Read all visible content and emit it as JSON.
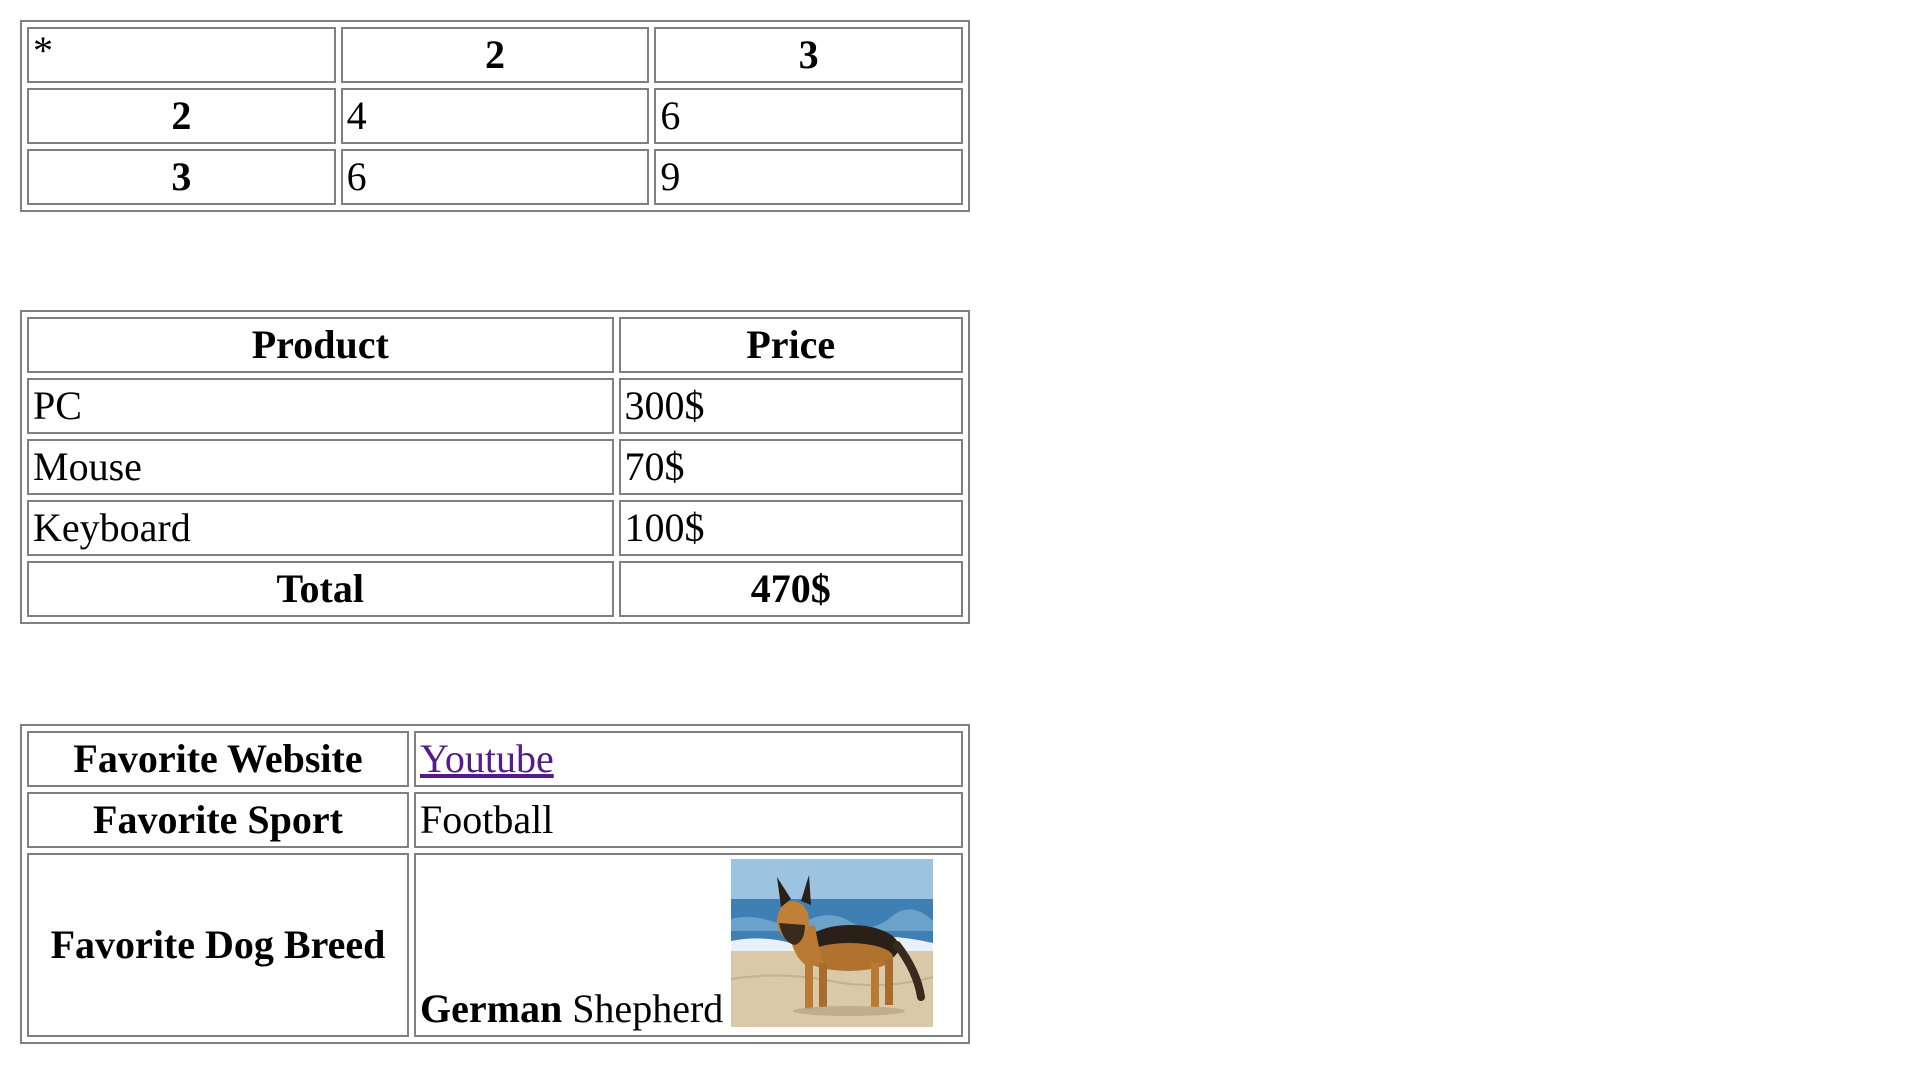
{
  "multiplication_table": {
    "corner": "*",
    "col_headers": [
      "2",
      "3"
    ],
    "rows": [
      {
        "header": "2",
        "cells": [
          "4",
          "6"
        ]
      },
      {
        "header": "3",
        "cells": [
          "6",
          "9"
        ]
      }
    ]
  },
  "product_table": {
    "headers": {
      "product": "Product",
      "price": "Price"
    },
    "rows": [
      {
        "product": "PC",
        "price": "300$"
      },
      {
        "product": "Mouse",
        "price": "70$"
      },
      {
        "product": "Keyboard",
        "price": "100$"
      }
    ],
    "total": {
      "label": "Total",
      "value": "470$"
    }
  },
  "favorites_table": {
    "website": {
      "label": "Favorite Website",
      "value": "Youtube"
    },
    "sport": {
      "label": "Favorite Sport",
      "value": "Football"
    },
    "dog": {
      "label": "Favorite Dog Breed",
      "value_bold": "German",
      "value_rest": " Shepherd"
    }
  },
  "colors": {
    "border": "#808080",
    "visited_link": "#551a8b"
  }
}
